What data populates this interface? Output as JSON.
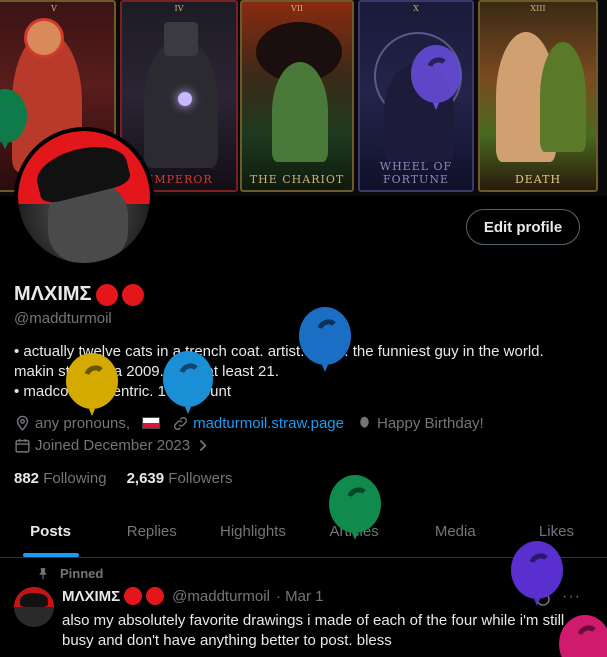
{
  "banner": {
    "cards": [
      {
        "label": "",
        "numeral": "V"
      },
      {
        "label": "EMPEROR",
        "numeral": "IV"
      },
      {
        "label": "THE CHARIOT",
        "numeral": "VII"
      },
      {
        "label": "WHEEL OF FORTUNE",
        "numeral": "X"
      },
      {
        "label": "DEATH",
        "numeral": "XIII"
      }
    ]
  },
  "profile": {
    "edit_label": "Edit profile",
    "display_name": "ΜΛΧΙΜΣ",
    "handle": "@maddturmoil",
    "bio": [
      "• actually twelve cats in a trench coat. artist. writer. the funniest guy in the world.",
      "makin stuff circa 2009. entp. at least 21.",
      "• madcom/oc centric. 18 account"
    ],
    "pronouns": "any pronouns,",
    "website": "madturmoil.straw.page",
    "birthday": "Happy Birthday!",
    "joined": "Joined December 2023",
    "following_count": "882",
    "following_label": "Following",
    "followers_count": "2,639",
    "followers_label": "Followers"
  },
  "tabs": [
    "Posts",
    "Replies",
    "Highlights",
    "Articles",
    "Media",
    "Likes"
  ],
  "tweet": {
    "pinned_label": "Pinned",
    "name": "ΜΛΧΙΜΣ",
    "handle": "@maddturmoil",
    "date": "· Mar 1",
    "text": "also my absolutely favorite drawings i made of each of the four while i'm still busy and don't have anything better to post. bless",
    "more": "···"
  },
  "colors": {
    "accent": "#1d9bf0",
    "name_dot": "#e3161c",
    "muted": "#71767b",
    "balloons": [
      "#0f7a4a",
      "#d4a900",
      "#1b8fd6",
      "#1a6fc4",
      "#118a4e",
      "#5a2fd0",
      "#d01a6e",
      "#6a4fe0"
    ]
  },
  "icons": [
    "location-icon",
    "link-icon",
    "balloon-icon",
    "calendar-icon",
    "chevron-right-icon",
    "pin-icon",
    "grok-icon",
    "more-icon"
  ]
}
